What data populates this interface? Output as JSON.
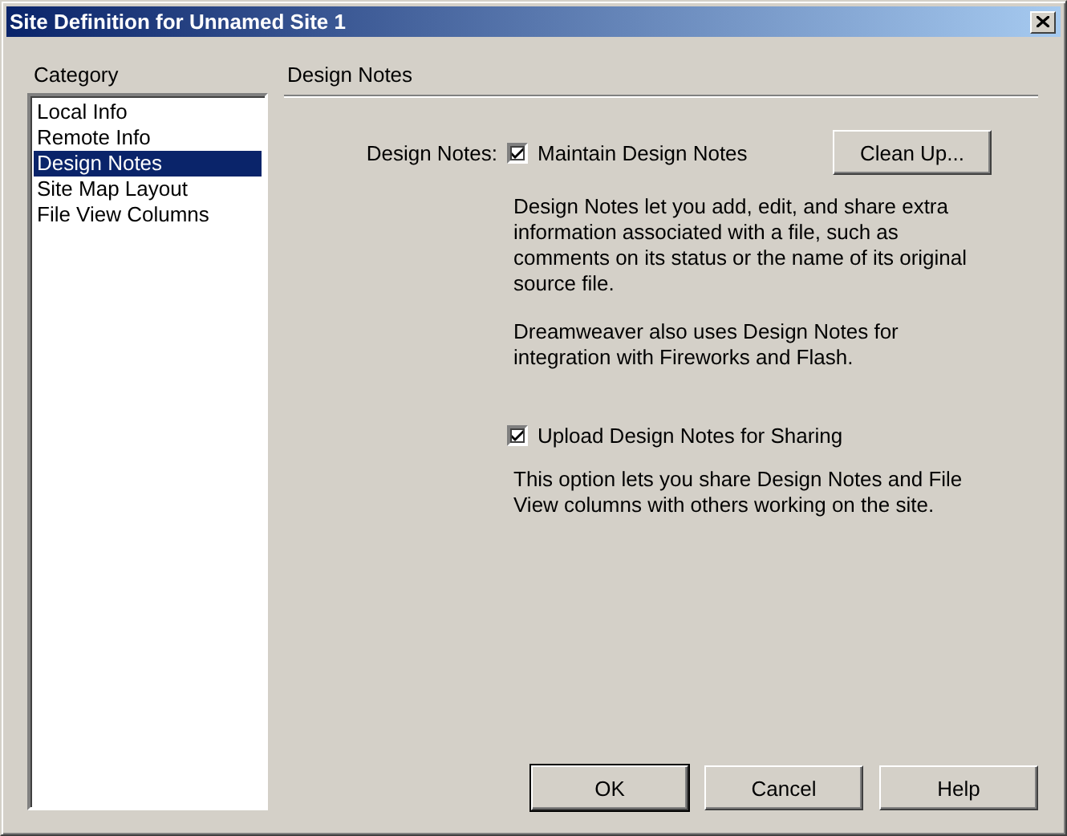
{
  "window": {
    "title": "Site Definition for Unnamed Site 1"
  },
  "category": {
    "label": "Category",
    "items": [
      {
        "label": "Local Info",
        "selected": false
      },
      {
        "label": "Remote Info",
        "selected": false
      },
      {
        "label": "Design Notes",
        "selected": true
      },
      {
        "label": "Site Map Layout",
        "selected": false
      },
      {
        "label": "File View Columns",
        "selected": false
      }
    ]
  },
  "panel": {
    "heading": "Design Notes",
    "field_label": "Design Notes:",
    "maintain": {
      "label": "Maintain Design Notes",
      "checked": true
    },
    "clean_up_button": "Clean Up...",
    "descriptions": [
      "Design Notes let you add, edit, and share extra information associated with a file, such as comments on its status or the name of its original source file.",
      "Dreamweaver also uses Design Notes for integration with Fireworks and Flash."
    ],
    "upload": {
      "label": "Upload Design Notes for Sharing",
      "checked": true
    },
    "upload_description": "This option lets you share Design Notes and File View columns with others working on the site."
  },
  "buttons": [
    {
      "label": "OK",
      "default": true
    },
    {
      "label": "Cancel",
      "default": false
    },
    {
      "label": "Help",
      "default": false
    }
  ]
}
